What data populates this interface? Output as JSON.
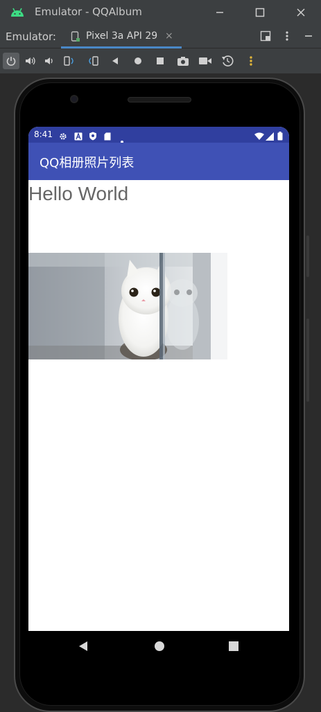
{
  "window": {
    "title": "Emulator - QQAlbum",
    "icons": [
      "android-icon",
      "minimize-icon",
      "maximize-icon",
      "close-icon"
    ]
  },
  "tabbar": {
    "label": "Emulator:",
    "tab_label": "Pixel 3a API 29",
    "tab_close": "×"
  },
  "toolbar": {
    "buttons": [
      "power-icon",
      "volume-up-icon",
      "volume-down-icon",
      "rotate-left-icon",
      "rotate-right-icon",
      "back-icon",
      "home-icon",
      "overview-icon",
      "screenshot-icon",
      "screen-record-icon",
      "snapshot-icon",
      "more-icon"
    ]
  },
  "device": {
    "status_bar": {
      "time": "8:41",
      "color": "#303f9f"
    },
    "app_bar": {
      "title": "QQ相册照片列表",
      "color": "#3f51b5"
    },
    "content": {
      "hello_text": "Hello World",
      "photo": "white-kitten-photo"
    }
  },
  "colors": {
    "ide_bg": "#3c3f41",
    "accent": "#4a88c7"
  }
}
